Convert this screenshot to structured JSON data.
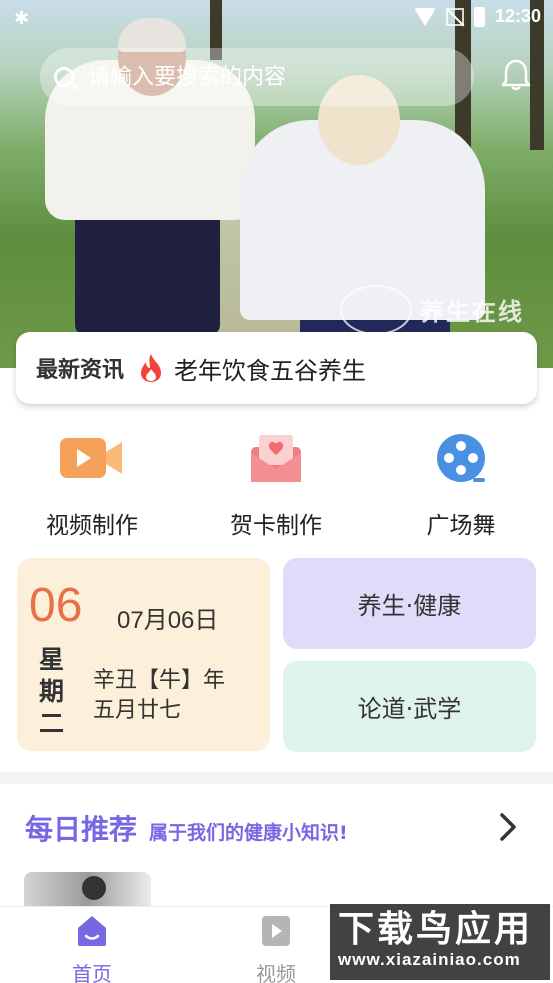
{
  "status_bar": {
    "time": "12:30"
  },
  "banner": {
    "watermark_text": "养生在线"
  },
  "search": {
    "placeholder": "请输入要搜索的内容"
  },
  "news": {
    "label": "最新资讯",
    "headline": "老年饮食五谷养生"
  },
  "quick_actions": [
    {
      "label": "视频制作",
      "icon": "video-camera-icon",
      "color": "#f6a15a"
    },
    {
      "label": "贺卡制作",
      "icon": "envelope-heart-icon",
      "color": "#f07d83"
    },
    {
      "label": "广场舞",
      "icon": "film-reel-icon",
      "color": "#4a90e2"
    }
  ],
  "date_card": {
    "day": "06",
    "date": "07月06日",
    "weekday": "星期二",
    "lunar_year": "辛丑【牛】年",
    "lunar_day": "五月廿七"
  },
  "categories": [
    {
      "label": "养生·健康",
      "color": "#dedcf8"
    },
    {
      "label": "论道·武学",
      "color": "#dff3ee"
    }
  ],
  "daily": {
    "title": "每日推荐",
    "subtitle": "属于我们的健康小知识!"
  },
  "tabs": [
    {
      "label": "首页",
      "active": true
    },
    {
      "label": "视频",
      "active": false
    }
  ],
  "watermark": {
    "big": "下载鸟应用",
    "small": "www.xiazainiao.com"
  },
  "colors": {
    "accent": "#7667e3",
    "date_orange": "#e9714a",
    "date_bg": "#fdf0db"
  }
}
